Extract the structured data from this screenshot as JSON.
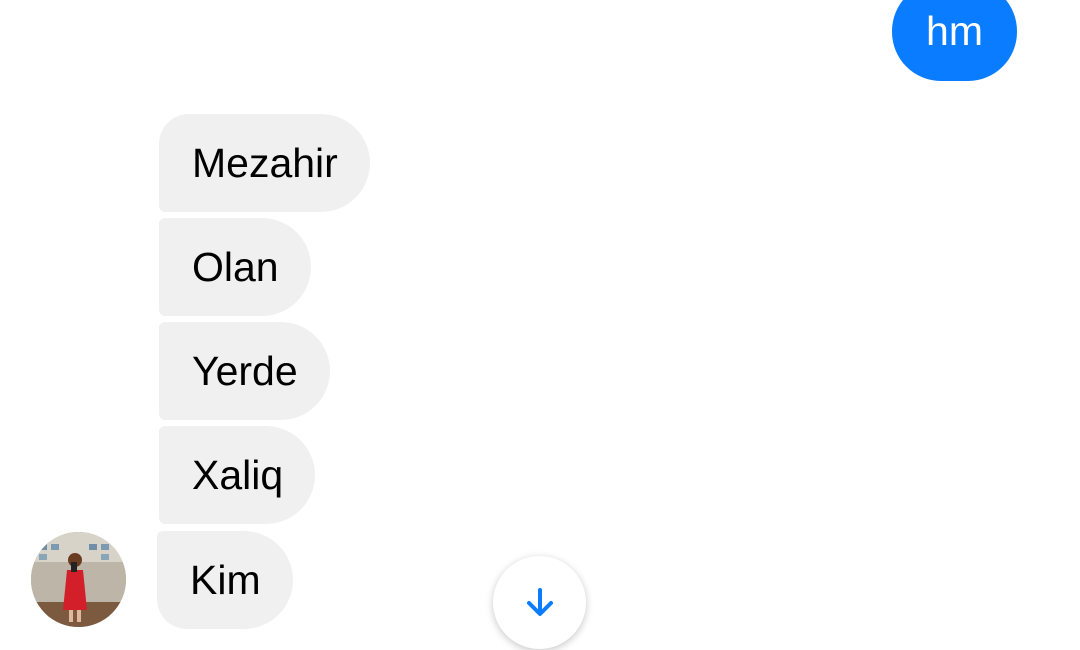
{
  "conversation": {
    "outgoing": [
      {
        "text": "hm"
      }
    ],
    "incoming": [
      {
        "text": "Mezahir"
      },
      {
        "text": "Olan"
      },
      {
        "text": "Yerde"
      },
      {
        "text": "Xaliq"
      },
      {
        "text": "Kim"
      }
    ]
  },
  "colors": {
    "outgoing_bubble": "#0a7cff",
    "incoming_bubble": "#f0f0f0",
    "accent_icon": "#0a7cff"
  },
  "icons": {
    "scroll_down": "arrow-down-icon",
    "contact_avatar": "avatar"
  }
}
